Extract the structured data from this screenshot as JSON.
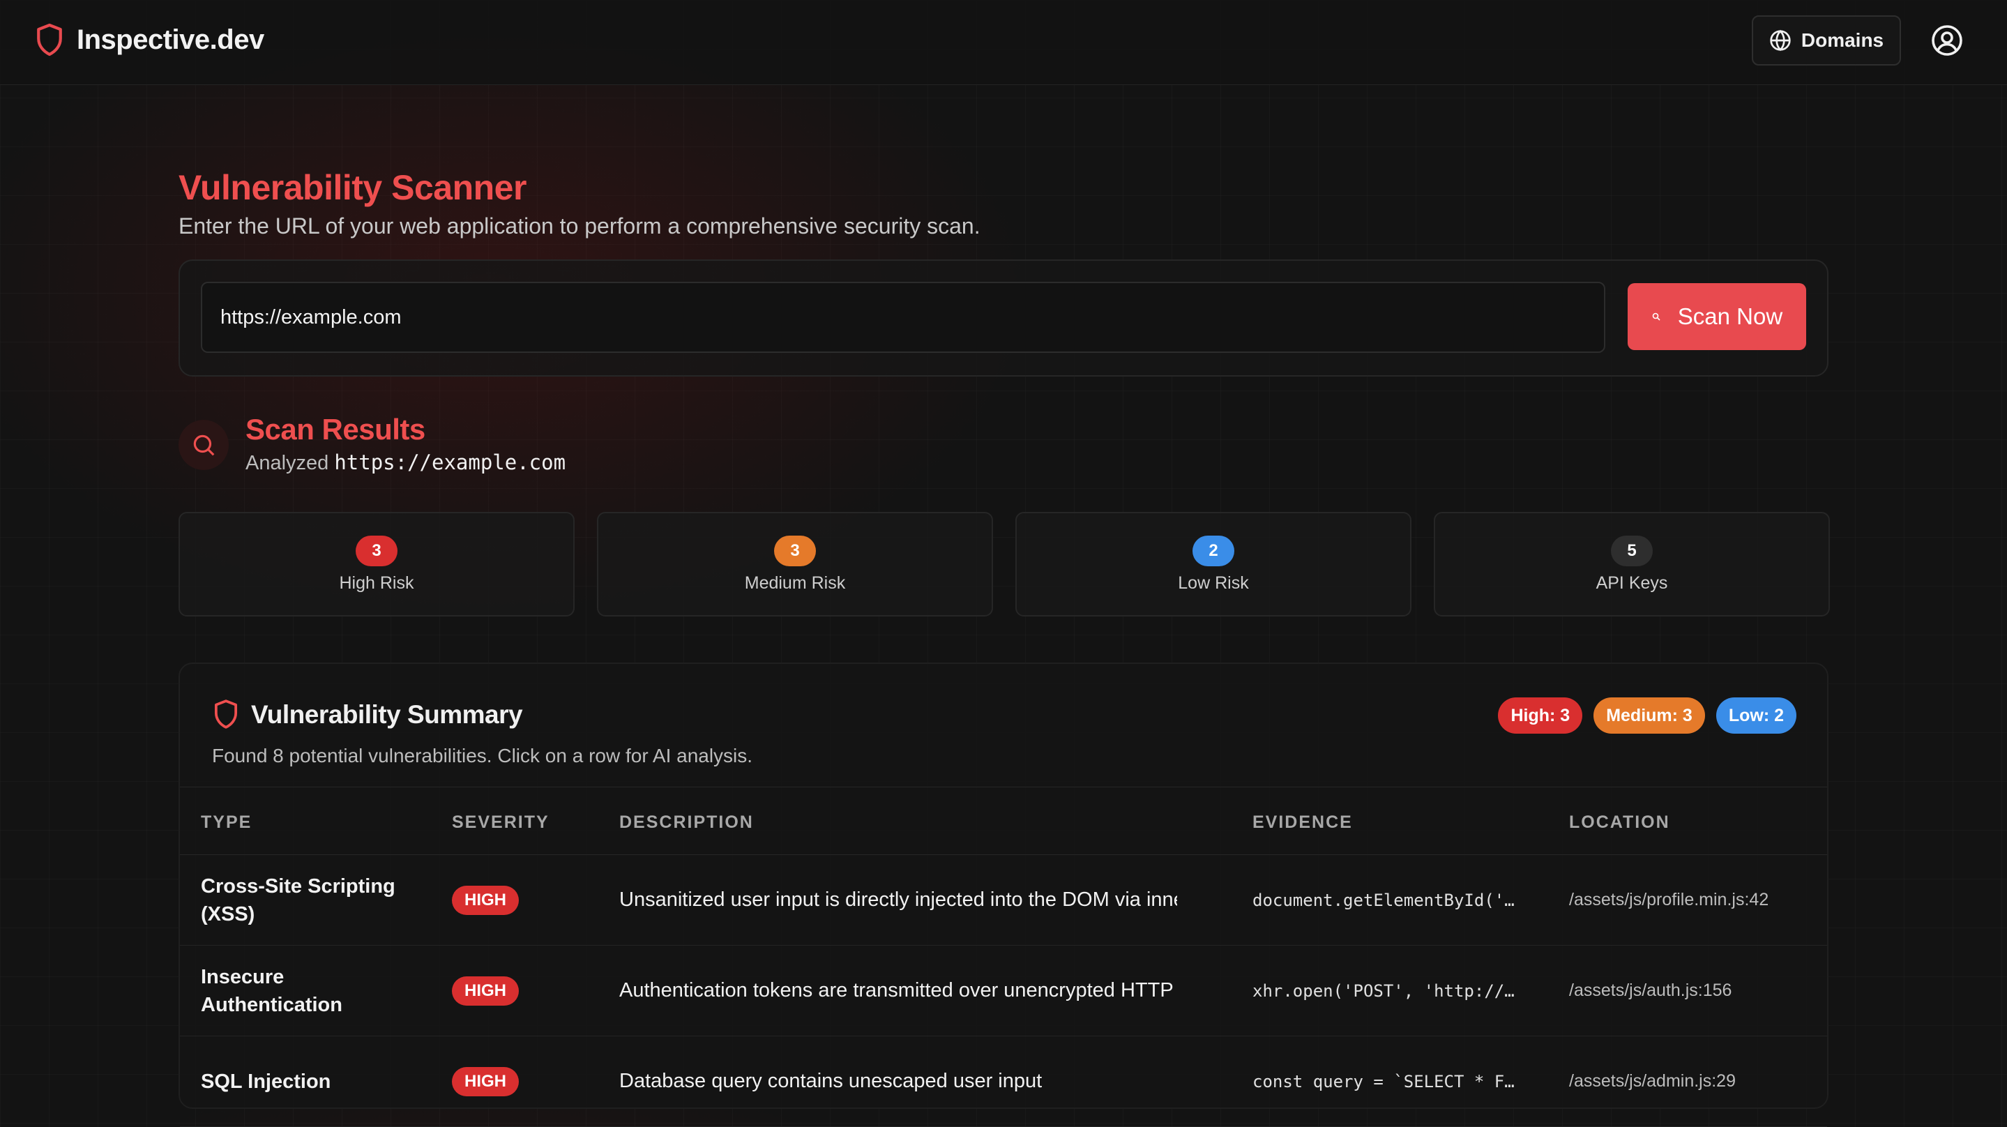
{
  "header": {
    "brand": "Inspective.dev",
    "domains_label": "Domains"
  },
  "scanner": {
    "title": "Vulnerability Scanner",
    "subtitle": "Enter the URL of your web application to perform a comprehensive security scan.",
    "url_value": "https://example.com",
    "scan_button": "Scan Now"
  },
  "results": {
    "title": "Scan Results",
    "analyzed_prefix": "Analyzed",
    "analyzed_url": "https://example.com",
    "stats": [
      {
        "count": "3",
        "label": "High Risk",
        "color": "#d92f2f"
      },
      {
        "count": "3",
        "label": "Medium Risk",
        "color": "#e57a2a"
      },
      {
        "count": "2",
        "label": "Low Risk",
        "color": "#3a8de8"
      },
      {
        "count": "5",
        "label": "API Keys",
        "color": "#2e2e2e"
      }
    ]
  },
  "summary": {
    "title": "Vulnerability Summary",
    "subtitle": "Found 8 potential vulnerabilities. Click on a row for AI analysis.",
    "pills": [
      {
        "text": "High: 3",
        "color": "#d92f2f"
      },
      {
        "text": "Medium: 3",
        "color": "#e57a2a"
      },
      {
        "text": "Low: 2",
        "color": "#3a8de8"
      }
    ],
    "columns": [
      "TYPE",
      "SEVERITY",
      "DESCRIPTION",
      "EVIDENCE",
      "LOCATION"
    ],
    "rows": [
      {
        "type": "Cross-Site Scripting (XSS)",
        "severity": "HIGH",
        "description": "Unsanitized user input is directly injected into the DOM via inne...",
        "evidence": "document.getElementById('…",
        "location": "/assets/js/profile.min.js:42"
      },
      {
        "type": "Insecure Authentication",
        "severity": "HIGH",
        "description": "Authentication tokens are transmitted over unencrypted HTTP ...",
        "evidence": "xhr.open('POST', 'http://…",
        "location": "/assets/js/auth.js:156"
      },
      {
        "type": "SQL Injection",
        "severity": "HIGH",
        "description": "Database query contains unescaped user input",
        "evidence": "const query = `SELECT * F…",
        "location": "/assets/js/admin.js:29"
      }
    ]
  },
  "colors": {
    "accent": "#ef4f4f",
    "button": "#e84a4f",
    "background": "#131313"
  }
}
